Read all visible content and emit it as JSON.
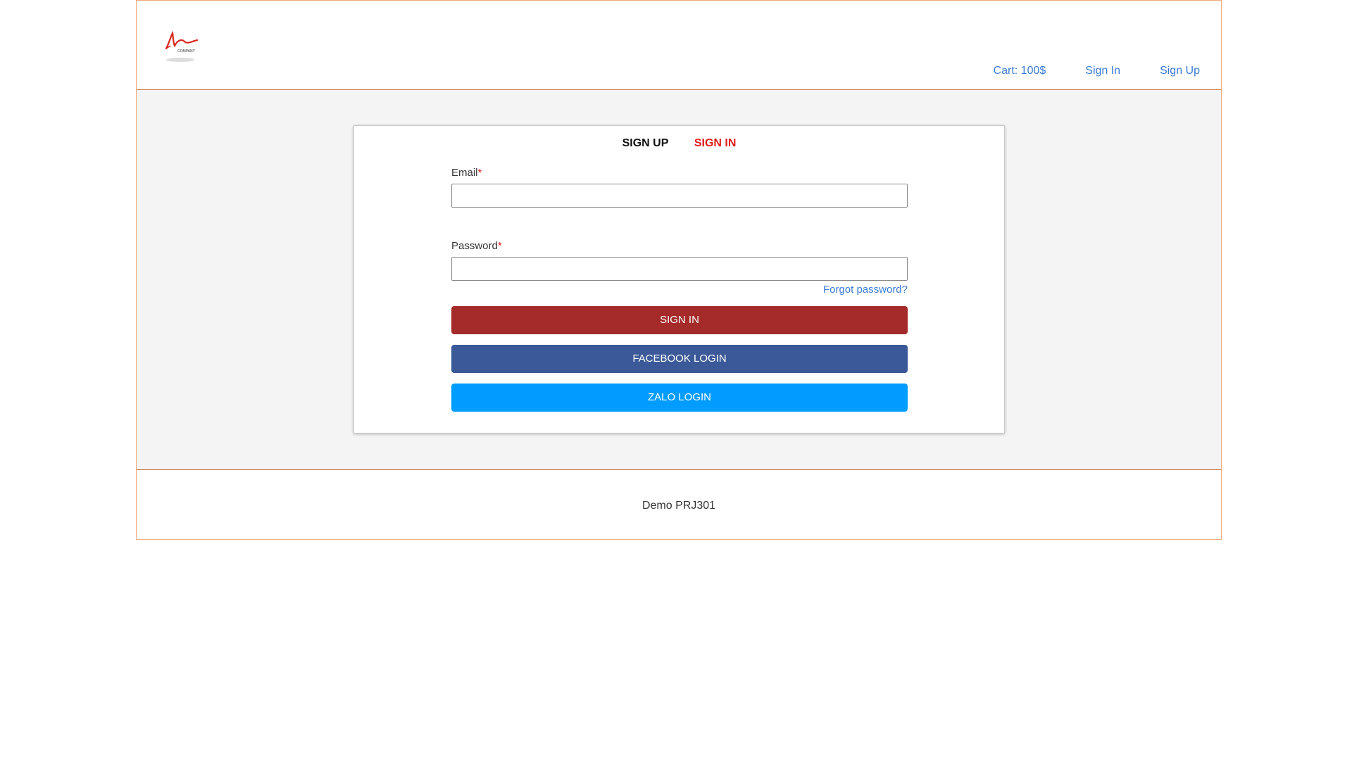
{
  "header": {
    "logo_text": "COMPANY",
    "nav": {
      "cart": "Cart: 100$",
      "sign_in": "Sign In",
      "sign_up": "Sign Up"
    }
  },
  "card": {
    "tabs": {
      "sign_up": "SIGN UP",
      "sign_in": "SIGN IN"
    },
    "email": {
      "label": "Email",
      "required_mark": "*",
      "value": "",
      "placeholder": ""
    },
    "password": {
      "label": "Password",
      "required_mark": "*",
      "value": "",
      "placeholder": ""
    },
    "forgot_password": "Forgot password?",
    "buttons": {
      "sign_in": "SIGN IN",
      "facebook": "FACEBOOK LOGIN",
      "zalo": "ZALO LOGIN"
    }
  },
  "footer": {
    "text": "Demo PRJ301"
  },
  "colors": {
    "page_border": "#f0a878",
    "divider": "#c8733c",
    "link": "#3a7bd5",
    "active_tab": "#e01b1b",
    "sign_in_button": "#a52a2a",
    "facebook_button": "#3b5998",
    "zalo_button": "#019cff",
    "main_background": "#f4f4f4"
  }
}
